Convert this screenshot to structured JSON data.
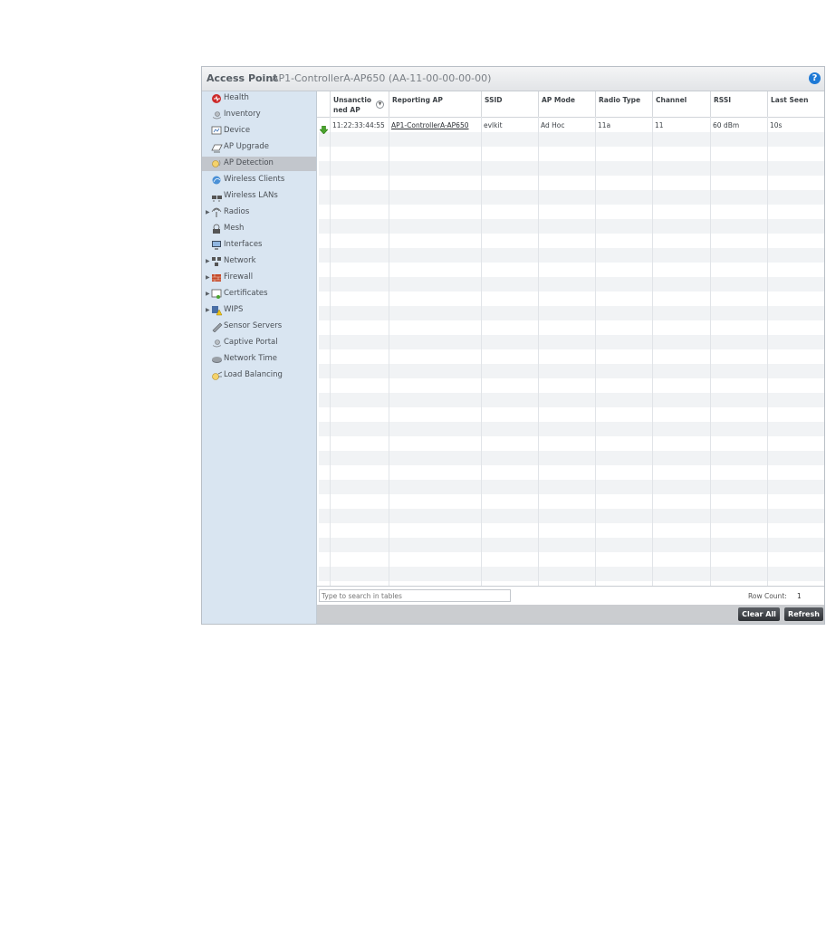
{
  "header": {
    "title": "Access Point",
    "device": "AP1-ControllerA-AP650 (AA-11-00-00-00-00)",
    "help": "?"
  },
  "sidebar": {
    "items": [
      {
        "label": "Health",
        "icon": "health-icon",
        "expandable": false,
        "selected": false
      },
      {
        "label": "Inventory",
        "icon": "inventory-icon",
        "expandable": false,
        "selected": false
      },
      {
        "label": "Device",
        "icon": "device-icon",
        "expandable": false,
        "selected": false
      },
      {
        "label": "AP Upgrade",
        "icon": "ap-upgrade-icon",
        "expandable": false,
        "selected": false
      },
      {
        "label": "AP Detection",
        "icon": "ap-detection-icon",
        "expandable": false,
        "selected": true
      },
      {
        "label": "Wireless Clients",
        "icon": "wireless-clients-icon",
        "expandable": false,
        "selected": false
      },
      {
        "label": "Wireless LANs",
        "icon": "wireless-lans-icon",
        "expandable": false,
        "selected": false
      },
      {
        "label": "Radios",
        "icon": "radios-icon",
        "expandable": true,
        "selected": false
      },
      {
        "label": "Mesh",
        "icon": "mesh-icon",
        "expandable": false,
        "selected": false
      },
      {
        "label": "Interfaces",
        "icon": "interfaces-icon",
        "expandable": false,
        "selected": false
      },
      {
        "label": "Network",
        "icon": "network-icon",
        "expandable": true,
        "selected": false
      },
      {
        "label": "Firewall",
        "icon": "firewall-icon",
        "expandable": true,
        "selected": false
      },
      {
        "label": "Certificates",
        "icon": "certificates-icon",
        "expandable": true,
        "selected": false
      },
      {
        "label": "WIPS",
        "icon": "wips-icon",
        "expandable": true,
        "selected": false
      },
      {
        "label": "Sensor Servers",
        "icon": "sensor-servers-icon",
        "expandable": false,
        "selected": false
      },
      {
        "label": "Captive Portal",
        "icon": "captive-portal-icon",
        "expandable": false,
        "selected": false
      },
      {
        "label": "Network Time",
        "icon": "network-time-icon",
        "expandable": false,
        "selected": false
      },
      {
        "label": "Load Balancing",
        "icon": "load-balancing-icon",
        "expandable": false,
        "selected": false
      }
    ]
  },
  "table": {
    "columns": [
      "Unsanctioned AP",
      "Reporting AP",
      "SSID",
      "AP Mode",
      "Radio Type",
      "Channel",
      "RSSI",
      "Last Seen"
    ],
    "col0_line1": "Unsanctio",
    "col0_line2": "ned AP",
    "sort_icon": "sort-icon",
    "rows": [
      {
        "status_icon": "green-down-arrow-icon",
        "cells": [
          "11:22:33:44:55",
          "AP1-ControllerA-AP650",
          "evlkit",
          "Ad Hoc",
          "11a",
          "11",
          "60 dBm",
          "10s"
        ]
      }
    ]
  },
  "footer": {
    "search_placeholder": "Type to search in tables",
    "row_count_label": "Row Count:",
    "row_count": "1"
  },
  "actions": {
    "clear_all": "Clear All",
    "refresh": "Refresh"
  },
  "colors": {
    "sidebar_bg": "#d9e5f1",
    "selected_bg": "#c2c6cc",
    "button_bg": "#3a3d41",
    "help_blue": "#1f7ad6",
    "status_green": "#4aa32d"
  }
}
